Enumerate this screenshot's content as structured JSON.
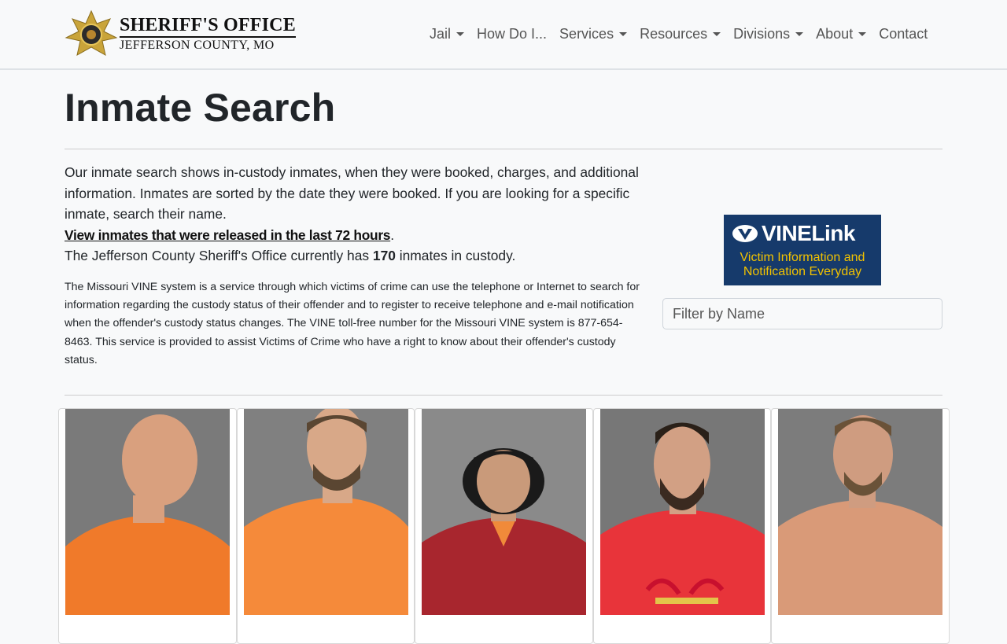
{
  "brand": {
    "title": "SHERIFF'S OFFICE",
    "subtitle": "JEFFERSON COUNTY, MO"
  },
  "nav": {
    "items": [
      {
        "label": "Jail",
        "dropdown": true
      },
      {
        "label": "How Do I...",
        "dropdown": false
      },
      {
        "label": "Services",
        "dropdown": true
      },
      {
        "label": "Resources",
        "dropdown": true
      },
      {
        "label": "Divisions",
        "dropdown": true
      },
      {
        "label": "About",
        "dropdown": true
      },
      {
        "label": "Contact",
        "dropdown": false
      }
    ]
  },
  "page": {
    "title": "Inmate Search",
    "intro": "Our inmate search shows in-custody inmates, when they were booked, charges, and additional information. Inmates are sorted by the date they were booked. If you are looking for a specific inmate, search their name.",
    "released_link": "View inmates that were released in the last 72 hours",
    "count_prefix": "The Jefferson County Sheriff's Office currently has ",
    "count": "170",
    "count_suffix": " inmates in custody.",
    "vine_text": "The Missouri VINE system is a service through which victims of crime can use the telephone or Internet to search for information regarding the custody status of their offender and to register to receive telephone and e-mail notification when the offender's custody status changes. The VINE toll-free number for the Missouri VINE system is 877-654-8463. This service is provided to assist Victims of Crime who have a right to know about their offender's custody status."
  },
  "vine_logo": {
    "brand": "VINELink",
    "tagline_1": "Victim Information and",
    "tagline_2": "Notification Everyday"
  },
  "filter": {
    "placeholder": "Filter by Name"
  },
  "inmates": [
    {
      "shirt": "#f07a2a",
      "skin": "#d9a07e",
      "hair": "none"
    },
    {
      "shirt": "#f58a3a",
      "skin": "#d8a888",
      "hair": "#5a4632"
    },
    {
      "shirt": "#a8262e",
      "skin": "#c99a7a",
      "hair": "#1a1a1a"
    },
    {
      "shirt": "#e8343a",
      "skin": "#d2a084",
      "hair": "#2a2018"
    },
    {
      "shirt": "#d99a78",
      "skin": "#cf9c80",
      "hair": "#6a5238"
    }
  ],
  "colors": {
    "vine_bg": "#163a6b",
    "vine_tagline": "#f2c200"
  }
}
